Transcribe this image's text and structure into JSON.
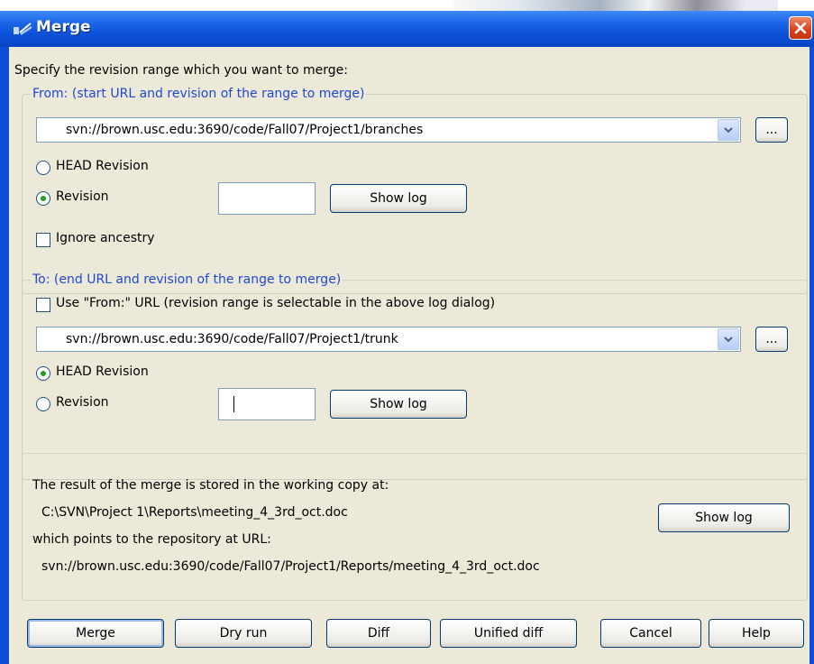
{
  "window": {
    "title": "Merge"
  },
  "intro": "Specify the revision range which you want to merge:",
  "from": {
    "group_title": "From: (start URL and revision of the range to merge)",
    "url": "svn://brown.usc.edu:3690/code/Fall07/Project1/branches",
    "browse_label": "...",
    "head_revision_label": "HEAD Revision",
    "revision_label": "Revision",
    "revision_value": "",
    "selected": "Revision",
    "show_log_label": "Show log",
    "ignore_ancestry_label": "Ignore ancestry",
    "ignore_ancestry_checked": false
  },
  "to": {
    "group_title": "To: (end URL and revision of the range to merge)",
    "use_from_label": "Use \"From:\" URL (revision range is selectable in the above log dialog)",
    "use_from_checked": false,
    "url": "svn://brown.usc.edu:3690/code/Fall07/Project1/trunk",
    "browse_label": "...",
    "head_revision_label": "HEAD Revision",
    "revision_label": "Revision",
    "revision_value": "",
    "selected": "HEAD Revision",
    "show_log_label": "Show log"
  },
  "result": {
    "line1": "The result of the merge is stored in the working copy at:",
    "path": "C:\\SVN\\Project 1\\Reports\\meeting_4_3rd_oct.doc",
    "line2": "which points to the repository at URL:",
    "url": "svn://brown.usc.edu:3690/code/Fall07/Project1/Reports/meeting_4_3rd_oct.doc",
    "show_log_label": "Show log"
  },
  "buttons": {
    "merge": "Merge",
    "dry_run": "Dry run",
    "diff": "Diff",
    "unified_diff": "Unified diff",
    "cancel": "Cancel",
    "help": "Help"
  },
  "colors": {
    "title_bar": "#0a4fd6",
    "group_title_text": "#1f49d4",
    "dialog_bg": "#ece9d8",
    "close_button": "#d8401c"
  }
}
